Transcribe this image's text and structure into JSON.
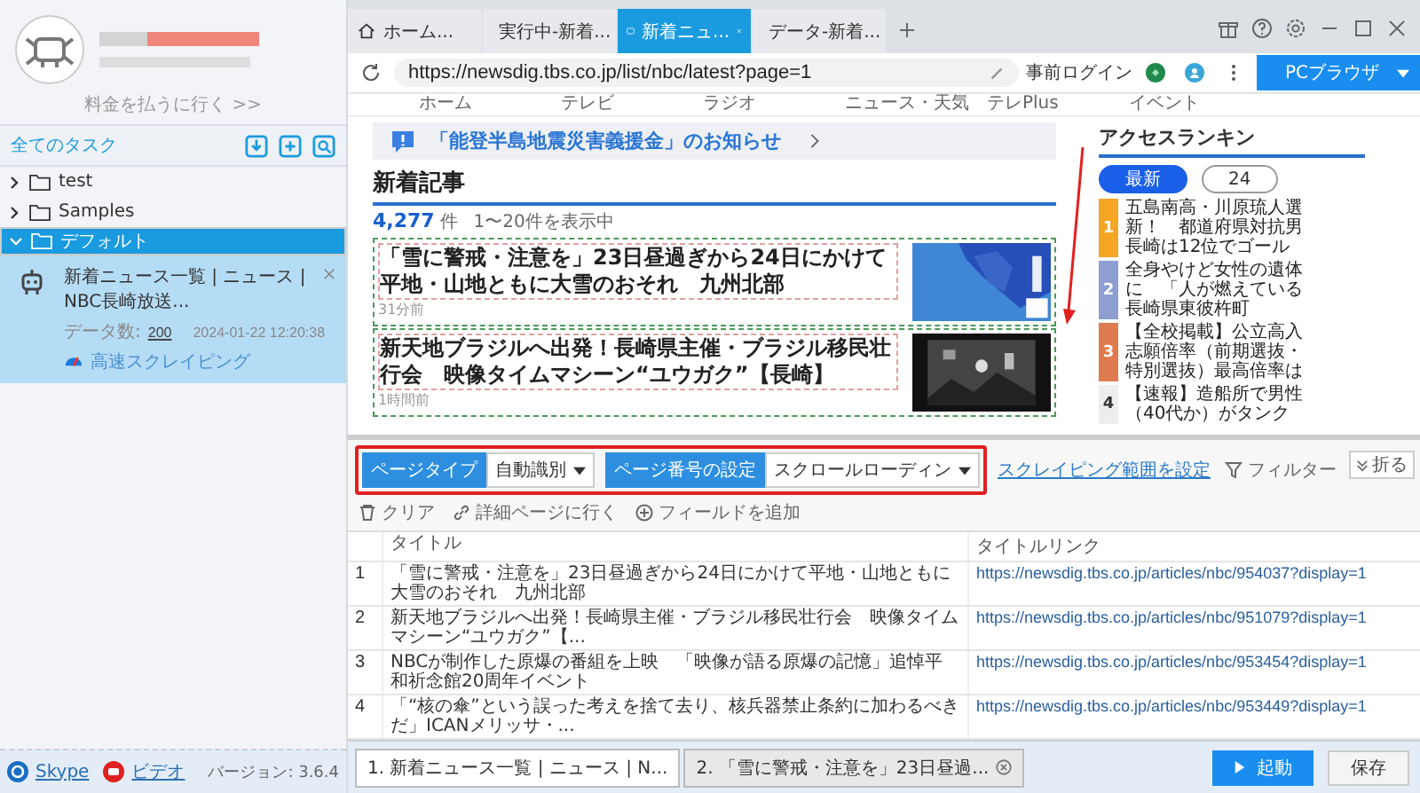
{
  "sidebar": {
    "pay_link": "料金を払うに行く >>",
    "section_title": "全てのタスク",
    "tree": [
      {
        "label": "test",
        "expanded": false,
        "selected": false
      },
      {
        "label": "Samples",
        "expanded": false,
        "selected": false
      },
      {
        "label": "デフォルト",
        "expanded": true,
        "selected": true,
        "tasks": [
          {
            "title": "新着ニュース一覧 | ニュース | NBC長崎放送...",
            "count_label": "データ数:",
            "count": "200",
            "date": "2024-01-22 12:20:38",
            "mode": "高速スクレイピング"
          }
        ]
      }
    ],
    "links": [
      {
        "kind": "skype",
        "label": "Skype"
      },
      {
        "kind": "video",
        "label": "ビデオ"
      }
    ],
    "version": "バージョン: 3.6.4"
  },
  "browser_tabs": [
    {
      "kind": "home",
      "label": "ホーム...",
      "selected": false
    },
    {
      "kind": "page",
      "label": "実行中-新着...",
      "selected": false
    },
    {
      "kind": "page",
      "label": "新着ニュ...",
      "selected": true
    },
    {
      "kind": "page",
      "label": "データ-新着...",
      "selected": false
    }
  ],
  "address_bar": {
    "url": "https://newsdig.tbs.co.jp/list/nbc/latest?page=1",
    "login": "事前ログイン",
    "mode_button": "PCブラウザ"
  },
  "webpage": {
    "nav": [
      "ホーム",
      "テレビ",
      "ラジオ",
      "ニュース・天気",
      "テレPlus",
      "イベント"
    ],
    "banner": "「能登半島地震災害義援金」のお知らせ",
    "heading": "新着記事",
    "count": "4,277",
    "count_unit": "件",
    "count_range": "1〜20件を表示中",
    "articles": [
      {
        "title": "「雪に警戒・注意を」23日昼過ぎから24日にかけて平地・山地ともに大雪のおそれ　九州北部",
        "time": "31分前"
      },
      {
        "title": "新天地ブラジルへ出発！長崎県主催・ブラジル移民壮行会　映像タイムマシーン“ユウガク”【長崎】",
        "time": "1時間前"
      }
    ],
    "ranking": {
      "title": "アクセスランキン",
      "tabs": [
        {
          "label": "最新",
          "selected": true
        },
        {
          "label": "24",
          "selected": false
        }
      ],
      "items": [
        {
          "rank": "1",
          "color": "#f5a623",
          "lines": [
            "五島南高・川原琉人選",
            "新！　都道府県対抗男",
            "長崎は12位でゴール"
          ]
        },
        {
          "rank": "2",
          "color": "#8d9fd0",
          "lines": [
            "全身やけど女性の遺体",
            "に　「人が燃えている",
            "長崎県東彼杵町"
          ]
        },
        {
          "rank": "3",
          "color": "#e07a4f",
          "lines": [
            "【全校掲載】公立高入",
            "志願倍率（前期選抜・",
            "特別選抜）最高倍率は"
          ]
        },
        {
          "rank": "4",
          "color": "#eeeeee",
          "lines": [
            "【速報】造船所で男性",
            "（40代か）がタンク"
          ]
        }
      ]
    }
  },
  "toolbar": {
    "page_type": {
      "label": "ページタイプ",
      "value": "自動識別"
    },
    "pagination": {
      "label": "ページ番号の設定",
      "value": "スクロールローディン"
    },
    "range_link": "スクレイピング範囲を設定",
    "actions": [
      {
        "kind": "filter",
        "label": "フィルター"
      },
      {
        "kind": "clear",
        "label": "クリア"
      },
      {
        "kind": "detail",
        "label": "詳細ページに行く"
      },
      {
        "kind": "add",
        "label": "フィールドを追加"
      }
    ],
    "collapse": "折る"
  },
  "table": {
    "columns": [
      "タイトル",
      "タイトルリンク"
    ],
    "rows": [
      {
        "index": "1",
        "title": "「雪に警戒・注意を」23日昼過ぎから24日にかけて平地・山地ともに大雪のおそれ　九州北部",
        "link": "https://newsdig.tbs.co.jp/articles/nbc/954037?display=1"
      },
      {
        "index": "2",
        "title": "新天地ブラジルへ出発！長崎県主催・ブラジル移民壮行会　映像タイムマシーン“ユウガク”【...",
        "link": "https://newsdig.tbs.co.jp/articles/nbc/951079?display=1"
      },
      {
        "index": "3",
        "title": "NBCが制作した原爆の番組を上映　「映像が語る原爆の記憶」追悼平和祈念館20周年イベント",
        "link": "https://newsdig.tbs.co.jp/articles/nbc/953454?display=1"
      },
      {
        "index": "4",
        "title": "「“核の傘”という誤った考えを捨て去り、核兵器禁止条約に加わるべきだ」ICANメリッサ・...",
        "link": "https://newsdig.tbs.co.jp/articles/nbc/953449?display=1"
      }
    ]
  },
  "result_tabs": [
    {
      "label": "1. 新着ニュース一覧 | ニュース | N...",
      "selected": true,
      "closable": false
    },
    {
      "label": "2. 「雪に警戒・注意を」23日昼過...",
      "selected": false,
      "closable": true
    }
  ],
  "buttons": {
    "start": "起動",
    "save": "保存"
  }
}
